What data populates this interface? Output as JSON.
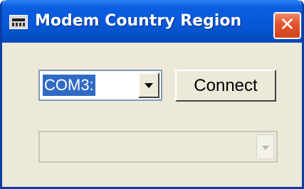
{
  "window": {
    "title": "Modem Country Region",
    "close_glyph": "✕",
    "icon": "keyboard-icon",
    "colors": {
      "titlebar": "#0758d8",
      "close": "#e0532c",
      "face": "#ece9d8",
      "selection": "#316ac5"
    }
  },
  "port_select": {
    "selected": "COM3:"
  },
  "connect_button": {
    "label": "Connect"
  },
  "region_select": {
    "selected": "",
    "enabled": false
  }
}
